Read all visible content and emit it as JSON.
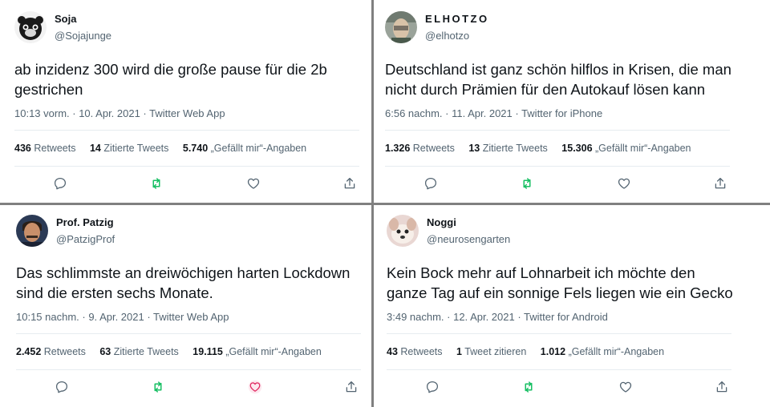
{
  "tweets": [
    {
      "name": "Soja",
      "handle": "@Sojajunge",
      "text": "ab inzidenz 300 wird die große pause für die 2b gestrichen",
      "meta": "10:13 vorm. · 10. Apr. 2021 · Twitter Web App",
      "retweets_count": "436",
      "retweets_label": "Retweets",
      "quotes_count": "14",
      "quotes_label": "Zitierte Tweets",
      "likes_count": "5.740",
      "likes_label": "„Gefällt mir“-Angaben",
      "liked": false
    },
    {
      "name": "ELHOTZO",
      "handle": "@elhotzo",
      "text": "Deutschland ist ganz schön hilflos in Krisen, die man nicht durch Prämien für den Autokauf lösen kann",
      "meta": "6:56 nachm. · 11. Apr. 2021 · Twitter for iPhone",
      "retweets_count": "1.326",
      "retweets_label": "Retweets",
      "quotes_count": "13",
      "quotes_label": "Zitierte Tweets",
      "likes_count": "15.306",
      "likes_label": "„Gefällt mir“-Angaben",
      "liked": false
    },
    {
      "name": "Prof. Patzig",
      "handle": "@PatzigProf",
      "text": "Das schlimmste an dreiwöchigen harten Lockdown sind die ersten sechs Monate.",
      "meta": "10:15 nachm. · 9. Apr. 2021 · Twitter Web App",
      "retweets_count": "2.452",
      "retweets_label": "Retweets",
      "quotes_count": "63",
      "quotes_label": "Zitierte Tweets",
      "likes_count": "19.115",
      "likes_label": "„Gefällt mir“-Angaben",
      "liked": true
    },
    {
      "name": "Noggi",
      "handle": "@neurosengarten",
      "text": "Kein Bock mehr auf Lohnarbeit ich möchte den ganze Tag auf ein sonnige Fels liegen wie ein Gecko",
      "meta": "3:49 nachm. · 12. Apr. 2021 · Twitter for Android",
      "retweets_count": "43",
      "retweets_label": "Retweets",
      "quotes_count": "1",
      "quotes_label": "Tweet zitieren",
      "likes_count": "1.012",
      "likes_label": "„Gefällt mir“-Angaben",
      "liked": false
    }
  ],
  "icons": [
    "reply-icon",
    "retweet-icon",
    "like-icon",
    "share-icon"
  ],
  "colors": {
    "text": "#0f1419",
    "secondary": "#536471",
    "retweet_green": "#17bf63",
    "like_pink": "#e0245e",
    "divider": "#808080"
  }
}
